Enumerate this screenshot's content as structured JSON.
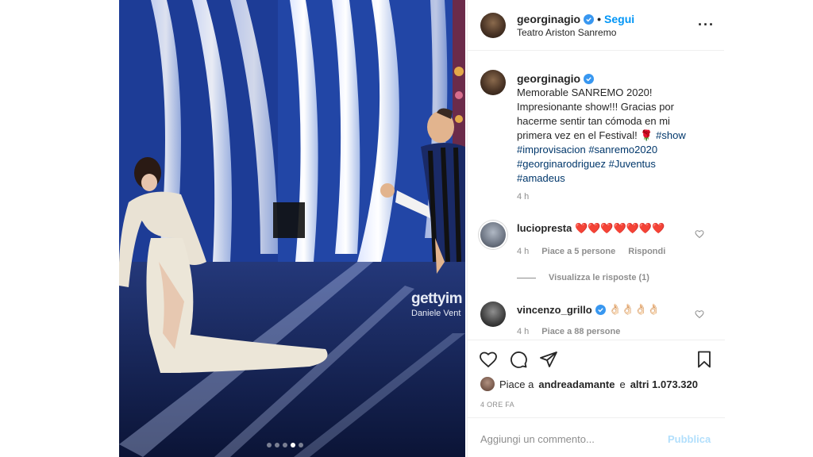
{
  "header": {
    "username": "georginagio",
    "separator": "•",
    "follow_label": "Segui",
    "location": "Teatro Ariston Sanremo",
    "more_icon": "more-horizontal-icon"
  },
  "photo": {
    "watermark_brand": "gettyim",
    "watermark_credit": "Daniele Vent",
    "carousel_dots": 5,
    "active_dot": 4
  },
  "caption": {
    "username": "georginagio",
    "lines": [
      "Memorable SANREMO 2020!",
      "Impresionante show!!! Gracias por",
      "hacerme sentir tan cómoda en mi",
      "primera vez en el Festival! 🌹 "
    ],
    "inline_tag": "#show",
    "tag_lines": [
      "#improvisacion #sanremo2020",
      "#georginarodriguez #Juventus",
      "#amadeus"
    ],
    "time": "4 h"
  },
  "comments": [
    {
      "username": "luciopresta",
      "text": "❤️❤️❤️❤️❤️❤️❤️",
      "time": "4 h",
      "likes": "Piace a 5 persone",
      "reply": "Rispondi"
    },
    {
      "username": "vincenzo_grillo",
      "text": "👌🏻👌🏻👌🏻👌🏻",
      "time": "4 h",
      "likes": "Piace a 88 persone"
    }
  ],
  "view_replies": "Visualizza le risposte (1)",
  "actions": {
    "like_icon": "heart-icon",
    "comment_icon": "comment-icon",
    "share_icon": "paper-plane-icon",
    "save_icon": "bookmark-icon"
  },
  "likes_summary": {
    "prefix": "Piace a",
    "user": "andreadamante",
    "middle": "e",
    "count": "altri 1.073.320"
  },
  "time_ago": "4 ORE FA",
  "comment_box": {
    "placeholder": "Aggiungi un commento...",
    "publish_label": "Pubblica"
  },
  "colors": {
    "accent": "#0095f6",
    "verified": "#3897f0",
    "publish_disabled": "#b2dffc",
    "hashtag": "#00376b"
  }
}
